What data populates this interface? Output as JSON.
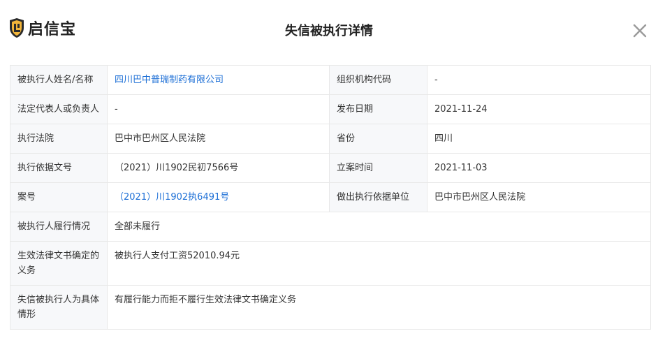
{
  "header": {
    "brand": "启信宝",
    "title": "失信被执行详情",
    "colors": {
      "brand_gold": "#f2b53a",
      "brand_dark": "#2b2b2b",
      "link": "#1d6fd6"
    },
    "close_icon": "close-icon"
  },
  "details": {
    "name_label": "被执行人姓名/名称",
    "name_value": "四川巴中普瑞制药有限公司",
    "org_code_label": "组织机构代码",
    "org_code_value": "-",
    "legal_rep_label": "法定代表人或负责人",
    "legal_rep_value": "-",
    "publish_date_label": "发布日期",
    "publish_date_value": "2021-11-24",
    "court_label": "执行法院",
    "court_value": "巴中市巴州区人民法院",
    "province_label": "省份",
    "province_value": "四川",
    "basis_doc_label": "执行依据文号",
    "basis_doc_value": "（2021）川1902民初7566号",
    "filing_date_label": "立案时间",
    "filing_date_value": "2021-11-03",
    "case_no_label": "案号",
    "case_no_value": "（2021）川1902执6491号",
    "basis_unit_label": "做出执行依据单位",
    "basis_unit_value": "巴中市巴州区人民法院",
    "performance_label": "被执行人履行情况",
    "performance_value": "全部未履行",
    "obligation_label": "生效法律文书确定的义务",
    "obligation_value": "被执行人支付工资52010.94元",
    "circumstance_label": "失信被执行人为具体情形",
    "circumstance_value": "有履行能力而拒不履行生效法律文书确定义务"
  }
}
